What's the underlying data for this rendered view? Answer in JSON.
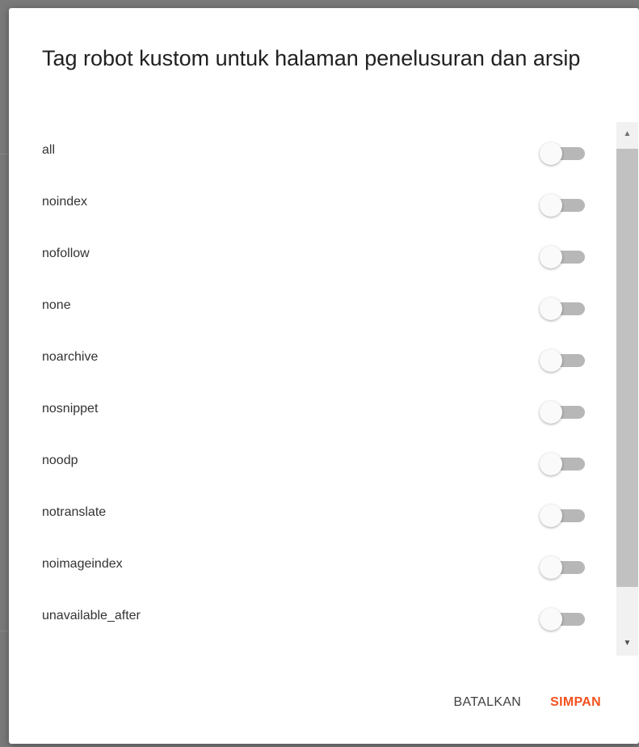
{
  "dialog": {
    "title": "Tag robot kustom untuk halaman penelusuran dan arsip",
    "items": [
      {
        "label": "all",
        "enabled": false
      },
      {
        "label": "noindex",
        "enabled": false
      },
      {
        "label": "nofollow",
        "enabled": false
      },
      {
        "label": "none",
        "enabled": false
      },
      {
        "label": "noarchive",
        "enabled": false
      },
      {
        "label": "nosnippet",
        "enabled": false
      },
      {
        "label": "noodp",
        "enabled": false
      },
      {
        "label": "notranslate",
        "enabled": false
      },
      {
        "label": "noimageindex",
        "enabled": false
      },
      {
        "label": "unavailable_after",
        "enabled": false
      }
    ],
    "scrollbar": {
      "up_icon": "triangle-up-icon",
      "down_icon": "triangle-down-icon"
    },
    "actions": {
      "cancel_label": "BATALKAN",
      "save_label": "SIMPAN"
    }
  },
  "colors": {
    "accent": "#f4511e",
    "toggle_track_off": "#b7b7b7",
    "toggle_thumb_off": "#fafafa",
    "overlay": "#7a7a7a"
  }
}
